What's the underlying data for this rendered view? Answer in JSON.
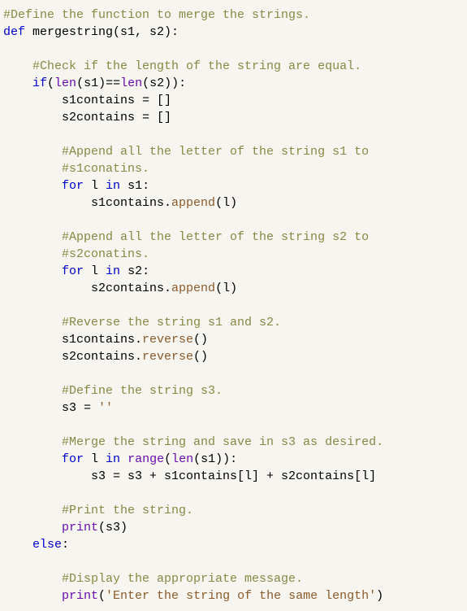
{
  "code": {
    "l1": "#Define the function to merge the strings.",
    "l2a": "def",
    "l2b": " mergestring(s1, s2):",
    "l3": "",
    "l4": "    #Check if the length of the string are equal.",
    "l5a": "    ",
    "l5b": "if",
    "l5c": "(",
    "l5d": "len",
    "l5e": "(s1)==",
    "l5f": "len",
    "l5g": "(s2)):",
    "l6": "        s1contains = []",
    "l7": "        s2contains = []",
    "l8": "",
    "l9": "        #Append all the letter of the string s1 to",
    "l10": "        #s1conatins.",
    "l11a": "        ",
    "l11b": "for",
    "l11c": " l ",
    "l11d": "in",
    "l11e": " s1:",
    "l12a": "            s1contains.",
    "l12b": "append",
    "l12c": "(l)",
    "l13": "",
    "l14": "        #Append all the letter of the string s2 to",
    "l15": "        #s2conatins.",
    "l16a": "        ",
    "l16b": "for",
    "l16c": " l ",
    "l16d": "in",
    "l16e": " s2:",
    "l17a": "            s2contains.",
    "l17b": "append",
    "l17c": "(l)",
    "l18": "",
    "l19": "        #Reverse the string s1 and s2.",
    "l20a": "        s1contains.",
    "l20b": "reverse",
    "l20c": "()",
    "l21a": "        s2contains.",
    "l21b": "reverse",
    "l21c": "()",
    "l22": "",
    "l23": "        #Define the string s3.",
    "l24a": "        s3 = ",
    "l24b": "''",
    "l25": "",
    "l26": "        #Merge the string and save in s3 as desired.",
    "l27a": "        ",
    "l27b": "for",
    "l27c": " l ",
    "l27d": "in",
    "l27e": " ",
    "l27f": "range",
    "l27g": "(",
    "l27h": "len",
    "l27i": "(s1)):",
    "l28": "            s3 = s3 + s1contains[l] + s2contains[l]",
    "l29": "",
    "l30": "        #Print the string.",
    "l31a": "        ",
    "l31b": "print",
    "l31c": "(s3)",
    "l32a": "    ",
    "l32b": "else",
    "l32c": ":",
    "l33": "",
    "l34": "        #Display the appropriate message.",
    "l35a": "        ",
    "l35b": "print",
    "l35c": "(",
    "l35d": "'Enter the string of the same length'",
    "l35e": ")"
  }
}
